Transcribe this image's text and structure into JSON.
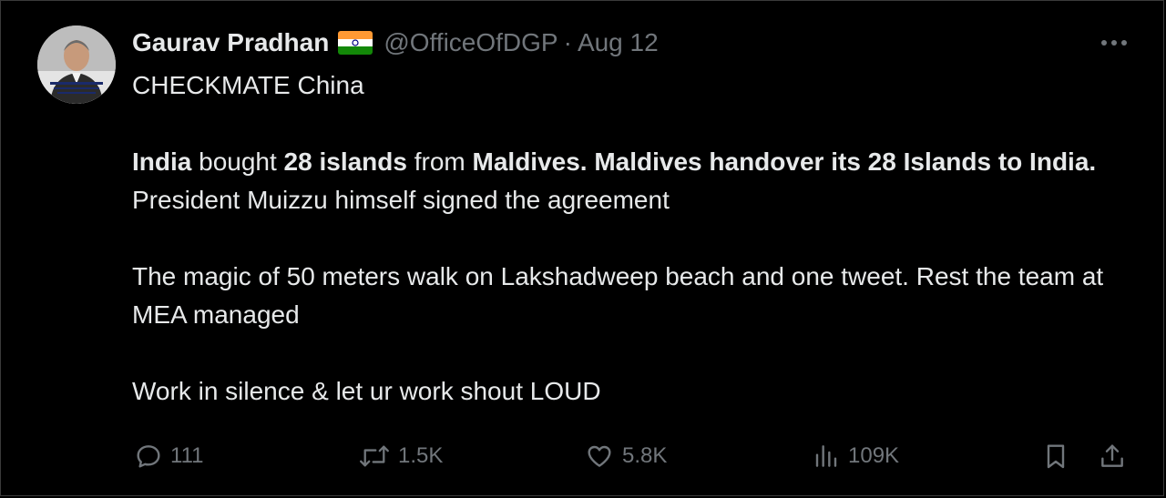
{
  "tweet": {
    "author_name": "Gaurav Pradhan",
    "handle": "@OfficeOfDGP",
    "separator": "·",
    "date": "Aug 12",
    "line1": "CHECKMATE China",
    "p2_india": "India",
    "p2_bought": " bought ",
    "p2_28islands": "28 islands",
    "p2_from": " from ",
    "p2_bold_rest": "Maldives. Maldives handover its 28 Islands to India.",
    "p2_tail": " President Muizzu himself signed the agreement",
    "p3": "The magic of 50 meters walk on Lakshadweep beach and one tweet. Rest the team at MEA managed",
    "p4": "Work in silence & let ur work shout LOUD"
  },
  "actions": {
    "replies": "111",
    "reposts": "1.5K",
    "likes": "5.8K",
    "views": "109K"
  },
  "icons": {
    "more": "more-icon",
    "reply": "reply-icon",
    "repost": "repost-icon",
    "like": "heart-icon",
    "views": "analytics-icon",
    "bookmark": "bookmark-icon",
    "share": "share-icon"
  },
  "colors": {
    "background": "#000000",
    "text": "#e7e9ea",
    "muted": "#71767b",
    "flag_saffron": "#ff9933",
    "flag_white": "#ffffff",
    "flag_green": "#138808",
    "flag_chakra": "#000080"
  }
}
